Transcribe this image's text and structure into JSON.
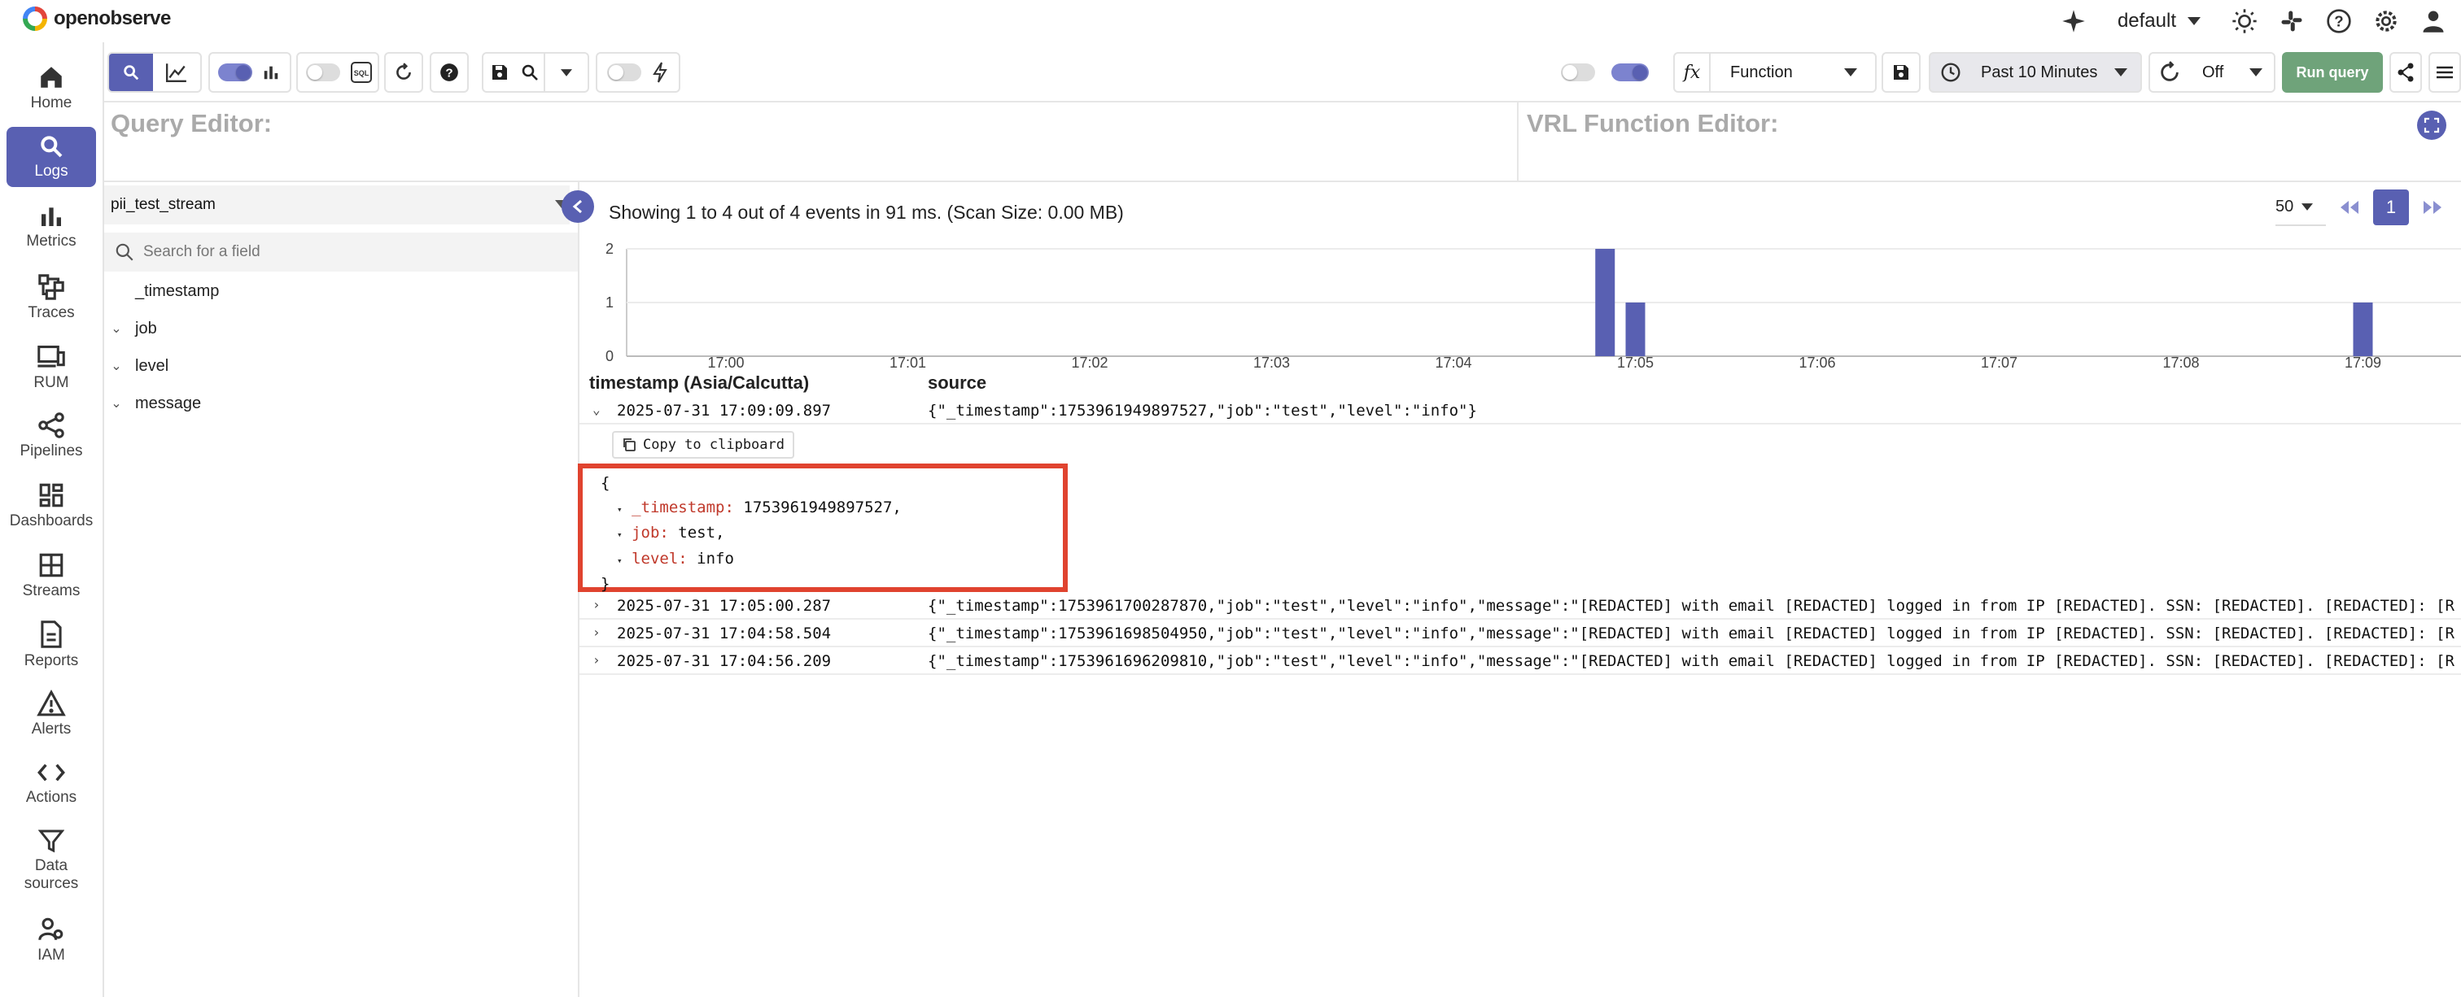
{
  "app": {
    "name": "openobserve",
    "org": "default"
  },
  "nav": {
    "items": [
      {
        "label": "Home",
        "icon": "home-icon"
      },
      {
        "label": "Logs",
        "icon": "search-icon",
        "active": true
      },
      {
        "label": "Metrics",
        "icon": "bar-chart-icon"
      },
      {
        "label": "Traces",
        "icon": "traces-icon"
      },
      {
        "label": "RUM",
        "icon": "devices-icon"
      },
      {
        "label": "Pipelines",
        "icon": "pipelines-icon"
      },
      {
        "label": "Dashboards",
        "icon": "dashboards-icon"
      },
      {
        "label": "Streams",
        "icon": "grid-icon"
      },
      {
        "label": "Reports",
        "icon": "document-icon"
      },
      {
        "label": "Alerts",
        "icon": "warning-icon"
      },
      {
        "label": "Actions",
        "icon": "code-icon"
      },
      {
        "label": "Data\nsources",
        "icon": "filter-icon"
      },
      {
        "label": "IAM",
        "icon": "users-icon"
      }
    ]
  },
  "toolbar": {
    "function_label": "Function",
    "time_range": "Past 10 Minutes",
    "refresh": "Off",
    "run_query": "Run query",
    "sql_label": "SQL"
  },
  "editors": {
    "query_title": "Query Editor:",
    "vrl_title": "VRL Function Editor:"
  },
  "fields": {
    "stream": "pii_test_stream",
    "search_placeholder": "Search for a field",
    "items": [
      "_timestamp",
      "job",
      "level",
      "message"
    ]
  },
  "results": {
    "summary": "Showing 1 to 4 out of 4 events in 91 ms. (Scan Size: 0.00 MB)",
    "per_page": "50",
    "page": "1",
    "columns": [
      "timestamp (Asia/Calcutta)",
      "source"
    ],
    "copy_label": "Copy to clipboard",
    "rows": [
      {
        "ts": "2025-07-31 17:09:09.897",
        "src": "{\"_timestamp\":1753961949897527,\"job\":\"test\",\"level\":\"info\"}",
        "expanded": true
      },
      {
        "ts": "2025-07-31 17:05:00.287",
        "src": "{\"_timestamp\":1753961700287870,\"job\":\"test\",\"level\":\"info\",\"message\":\"[REDACTED] with email [REDACTED] logged in from IP [REDACTED]. SSN: [REDACTED]. [REDACTED]: [R"
      },
      {
        "ts": "2025-07-31 17:04:58.504",
        "src": "{\"_timestamp\":1753961698504950,\"job\":\"test\",\"level\":\"info\",\"message\":\"[REDACTED] with email [REDACTED] logged in from IP [REDACTED]. SSN: [REDACTED]. [REDACTED]: [R"
      },
      {
        "ts": "2025-07-31 17:04:56.209",
        "src": "{\"_timestamp\":1753961696209810,\"job\":\"test\",\"level\":\"info\",\"message\":\"[REDACTED] with email [REDACTED] logged in from IP [REDACTED]. SSN: [REDACTED]. [REDACTED]: [R"
      }
    ],
    "json": {
      "open": "{",
      "close": "}",
      "lines": [
        {
          "key": "_timestamp:",
          "value": "1753961949897527,"
        },
        {
          "key": "job:",
          "value": "test,"
        },
        {
          "key": "level:",
          "value": "info"
        }
      ]
    }
  },
  "chart_data": {
    "type": "bar",
    "x_ticks": [
      "17:00",
      "17:01",
      "17:02",
      "17:03",
      "17:04",
      "17:05",
      "17:06",
      "17:07",
      "17:08",
      "17:09"
    ],
    "y_ticks": [
      "0",
      "1",
      "2"
    ],
    "ylim": [
      0,
      2
    ],
    "bars": [
      {
        "time": "17:04:50",
        "value": 2
      },
      {
        "time": "17:05:00",
        "value": 1
      },
      {
        "time": "17:09:00",
        "value": 1
      }
    ],
    "bar_color": "#5960b2"
  },
  "colors": {
    "accent": "#5960b2",
    "run_button": "#6fa37a",
    "highlight_box": "#e0432f"
  }
}
